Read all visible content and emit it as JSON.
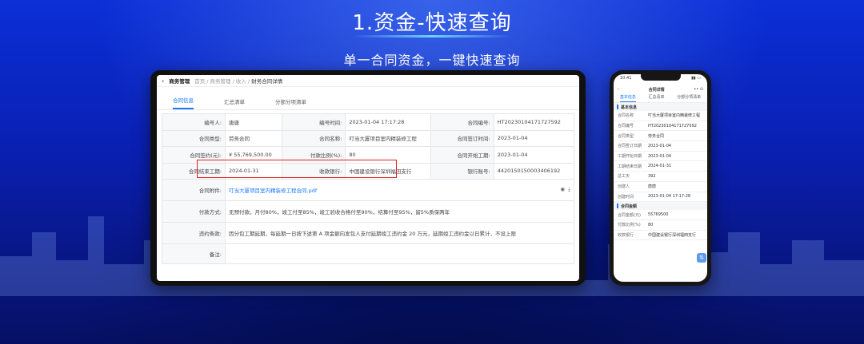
{
  "title": "1.资金-快速查询",
  "subtitle": "单一合同资金，一键快速查询",
  "tablet": {
    "module": "商务管理",
    "breadcrumbs": [
      "首页",
      "商务管理",
      "收入",
      "财务合同详情"
    ],
    "tabs": [
      "合同信息",
      "汇总清单",
      "分部分项清单"
    ],
    "active_tab": "合同信息",
    "fields": {
      "no_label": "编号人:",
      "no_value": "唐唐",
      "time_label": "编号时间:",
      "time_value": "2023-01-04 17:17:28",
      "code_label": "合同编号:",
      "code_value": "HT20230104171727592",
      "type_label": "合同类型:",
      "type_value": "劳务合同",
      "name_label": "合同名称:",
      "name_value": "叮当大厦项目室内精装修工程",
      "sign_label": "合同签订时间:",
      "sign_value": "2023-01-04",
      "amount_label": "合同签约(元):",
      "amount_value": "¥ 55,769,500.00",
      "ratio_label": "付款比例(%):",
      "ratio_value": "80",
      "start_label": "合同开始工期:",
      "start_value": "2023-01-04",
      "end_label": "合同结束工期:",
      "end_value": "2024-01-31",
      "bank_label": "收款银行:",
      "bank_value": "中国建设银行深圳福田支行",
      "acct_label": "银行账号:",
      "acct_value": "4420150150003406192",
      "attach_label": "合同附件:",
      "attach_value": "叮当大厦项目室内精装修工程合同.pdf",
      "pay_label": "付款方式:",
      "pay_value": "无预付款。月付80%，竣工付至85%，竣工验收合格付至90%，结算付至95%，留5%质保两年",
      "breach_label": "违约条款:",
      "breach_value": "因分包工期延期，每延期一日按下述第 A 项金额向发包人支付延期竣工违约金 20 万元，延期竣工违约金以日累计，不设上限",
      "note_label": "备注:",
      "note_value": ""
    }
  },
  "phone": {
    "time": "10:41",
    "title": "合同详情",
    "tabs": [
      "基本信息",
      "汇总清单",
      "分部分项清单"
    ],
    "active_tab": "基本信息",
    "section1": "基本信息",
    "rows": [
      {
        "k": "合同名称",
        "v": "叮当大厦项目室内精装修工程"
      },
      {
        "k": "合同编号",
        "v": "HT20230104171727592"
      },
      {
        "k": "合同类型",
        "v": "劳务合同"
      },
      {
        "k": "合同签订日期",
        "v": "2023-01-04"
      },
      {
        "k": "工期开始日期",
        "v": "2023-01-04"
      },
      {
        "k": "工期结束日期",
        "v": "2024-01-31"
      },
      {
        "k": "总工天",
        "v": "392"
      },
      {
        "k": "创建人",
        "v": "唐唐"
      },
      {
        "k": "创建时间",
        "v": "2023-01-04 17:17:28"
      }
    ],
    "section2": "合同金额",
    "rows2": [
      {
        "k": "合同金额(元)",
        "v": "55769500"
      },
      {
        "k": "付款比例(%)",
        "v": "80"
      },
      {
        "k": "收款银行",
        "v": "中国建设银行深圳福田支行"
      }
    ]
  }
}
